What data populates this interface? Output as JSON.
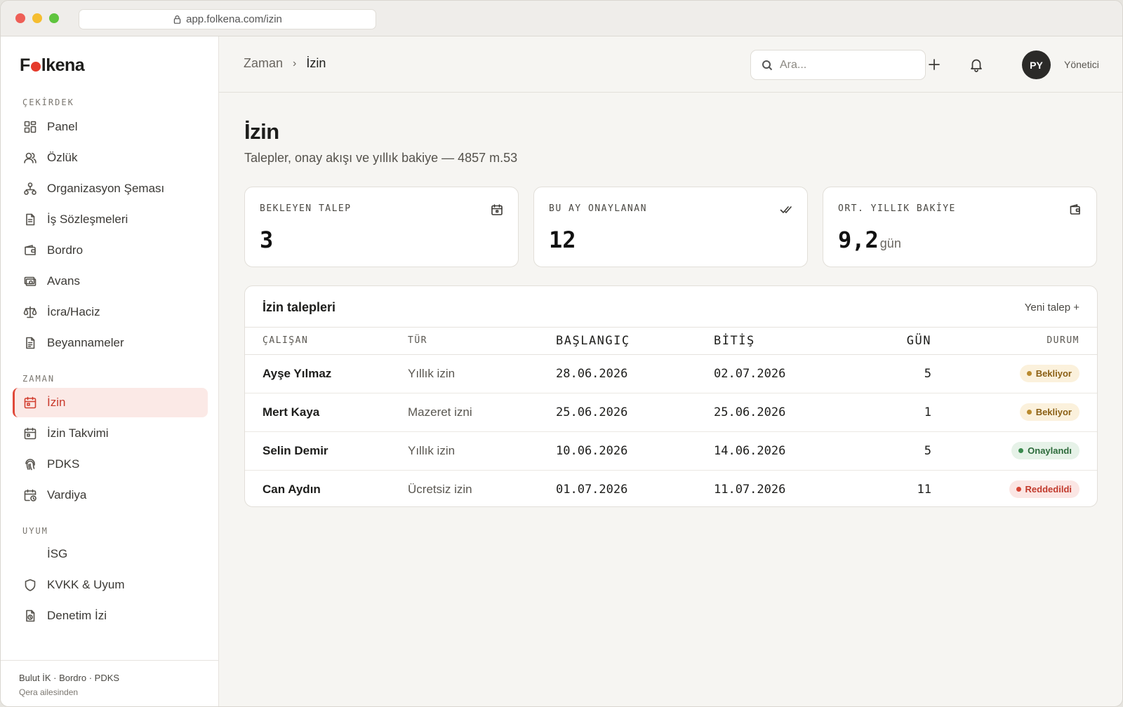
{
  "browser": {
    "url": "app.folkena.com/izin"
  },
  "brand": {
    "name_before": "F",
    "name_after": "lkena",
    "accent": "#e53b2c"
  },
  "sidebar": {
    "sections": {
      "core": "ÇEKİRDEK",
      "time": "ZAMAN",
      "compliance": "UYUM"
    },
    "items": {
      "panel": "Panel",
      "ozluk": "Özlük",
      "org": "Organizasyon Şeması",
      "contracts": "İş Sözleşmeleri",
      "payroll": "Bordro",
      "advance": "Avans",
      "garnish": "İcra/Haciz",
      "declarations": "Beyannameler",
      "leave": "İzin",
      "leave_calendar": "İzin Takvimi",
      "pdks": "PDKS",
      "shift": "Vardiya",
      "isg": "İSG",
      "kvkk": "KVKK & Uyum",
      "audit": "Denetim İzi"
    },
    "footer": {
      "products": "Bulut İK · Bordro · PDKS",
      "family": "Qera ailesinden"
    }
  },
  "topbar": {
    "breadcrumb": [
      "Zaman",
      "İzin"
    ],
    "search_placeholder": "Ara...",
    "avatar_initials": "PY",
    "role": "Yönetici"
  },
  "page": {
    "title": "İzin",
    "subtitle": "Talepler, onay akışı ve yıllık bakiye — 4857 m.53"
  },
  "stats": [
    {
      "label": "BEKLEYEN TALEP",
      "value": "3",
      "unit": "",
      "icon": "calendar-icon"
    },
    {
      "label": "BU AY ONAYLANAN",
      "value": "12",
      "unit": "",
      "icon": "double-check-icon"
    },
    {
      "label": "ORT. YILLIK BAKİYE",
      "value": "9,2",
      "unit": "gün",
      "icon": "wallet-icon"
    }
  ],
  "requests": {
    "title": "İzin talepleri",
    "new_label": "Yeni talep +",
    "columns": [
      "ÇALIŞAN",
      "TÜR",
      "BAŞLANGIÇ",
      "BİTİŞ",
      "GÜN",
      "DURUM"
    ],
    "rows": [
      {
        "name": "Ayşe Yılmaz",
        "type": "Yıllık izin",
        "start": "28.06.2026",
        "end": "02.07.2026",
        "days": "5",
        "status": "Bekliyor",
        "status_kind": "pending"
      },
      {
        "name": "Mert Kaya",
        "type": "Mazeret izni",
        "start": "25.06.2026",
        "end": "25.06.2026",
        "days": "1",
        "status": "Bekliyor",
        "status_kind": "pending"
      },
      {
        "name": "Selin Demir",
        "type": "Yıllık izin",
        "start": "10.06.2026",
        "end": "14.06.2026",
        "days": "5",
        "status": "Onaylandı",
        "status_kind": "approved"
      },
      {
        "name": "Can Aydın",
        "type": "Ücretsiz izin",
        "start": "01.07.2026",
        "end": "11.07.2026",
        "days": "11",
        "status": "Reddedildi",
        "status_kind": "rejected"
      }
    ]
  },
  "colors": {
    "pending": "#b98a2e",
    "approved": "#3a8a4e",
    "rejected": "#d64535",
    "active_nav_bg": "#fbe9e6"
  }
}
